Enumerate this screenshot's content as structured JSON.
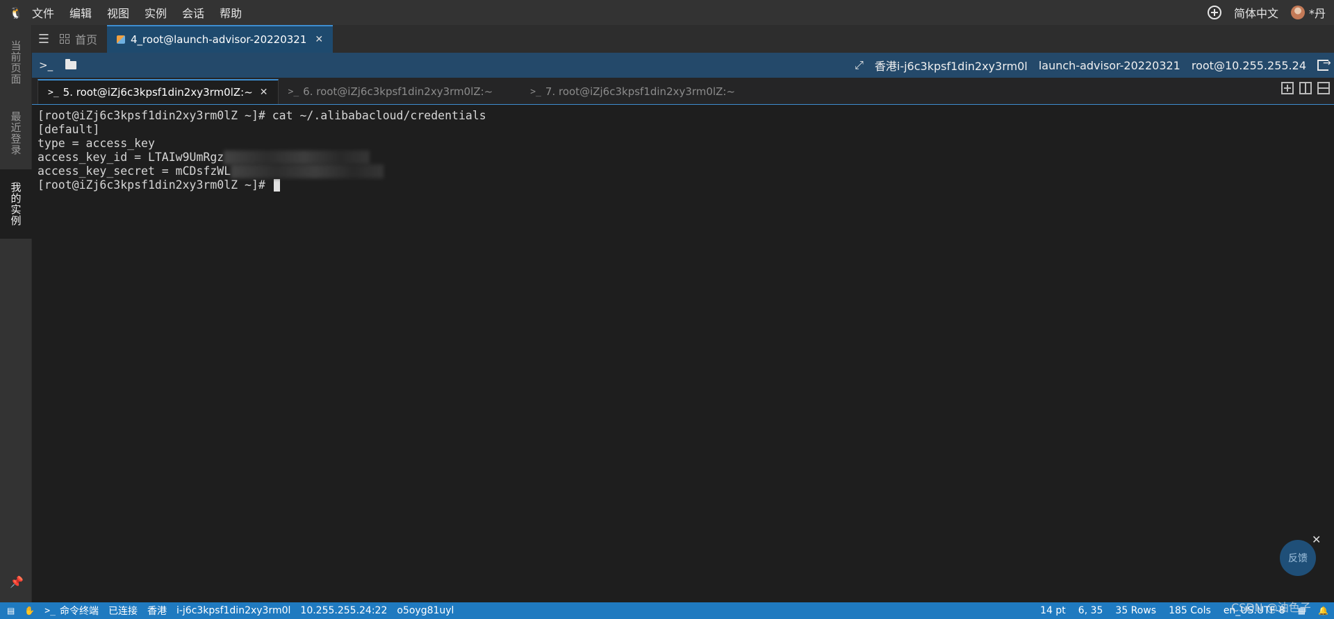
{
  "menu": {
    "items": [
      "文件",
      "编辑",
      "视图",
      "实例",
      "会话",
      "帮助"
    ],
    "language": "简体中文",
    "user": "*丹"
  },
  "sidebar": {
    "tabs": [
      "当前页面",
      "最近登录",
      "我的实例"
    ]
  },
  "tabs": {
    "home": "首页",
    "session": "4_root@launch-advisor-20220321"
  },
  "toolbar": {
    "region_instance": "香港i-j6c3kpsf1din2xy3rm0l",
    "instance_name": "launch-advisor-20220321",
    "login": "root@10.255.255.24"
  },
  "subtabs": [
    {
      "label": "5. root@iZj6c3kpsf1din2xy3rm0lZ:~"
    },
    {
      "label": "6. root@iZj6c3kpsf1din2xy3rm0lZ:~"
    },
    {
      "label": "7. root@iZj6c3kpsf1din2xy3rm0lZ:~"
    }
  ],
  "terminal": {
    "lines": [
      "[root@iZj6c3kpsf1din2xy3rm0lZ ~]# cat ~/.alibabacloud/credentials",
      "[default]",
      "type = access_key",
      "access_key_id = LTAIw9UmRgz",
      "access_key_secret = mCDsfzWL",
      "[root@iZj6c3kpsf1din2xy3rm0lZ ~]# "
    ]
  },
  "feedback": "反馈",
  "statusbar": {
    "mode": "命令终端",
    "connection": "已连接",
    "region": "香港",
    "instance_id": "i-j6c3kpsf1din2xy3rm0l",
    "address": "10.255.255.24:22",
    "session_id": "o5oyg81uyl",
    "font_size": "14 pt",
    "cursor_pos": "6, 35",
    "rows": "35 Rows",
    "cols": "185 Cols",
    "locale": "en_US.UTF-8"
  },
  "watermark": "CSDN @油色子",
  "colors": {
    "accent": "#1f7ac0",
    "toolbar": "#24496a",
    "active_tab": "#1e4a6e"
  }
}
